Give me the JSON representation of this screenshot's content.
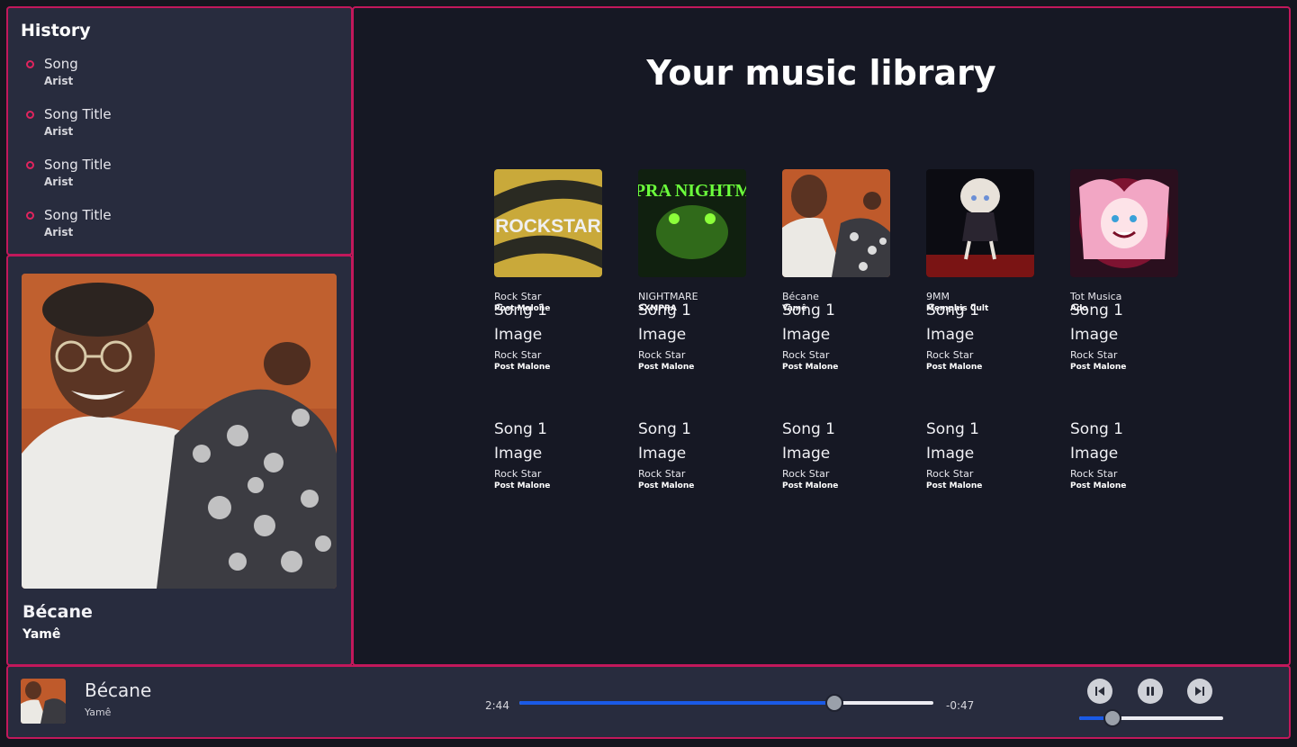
{
  "history": {
    "title": "History",
    "items": [
      {
        "song": "Song",
        "artist": "Arist"
      },
      {
        "song": "Song Title",
        "artist": "Arist"
      },
      {
        "song": "Song Title",
        "artist": "Arist"
      },
      {
        "song": "Song Title",
        "artist": "Arist"
      }
    ]
  },
  "now_playing": {
    "title": "Bécane",
    "artist": "Yamê"
  },
  "library": {
    "title": "Your music library",
    "albums": [
      {
        "title": "Rock Star",
        "artist": "Post Malone",
        "cover_text": "ROCKSTAR"
      },
      {
        "title": "NIGHTMARE",
        "artist": "SXMPRA",
        "cover_text": "SXMPRA NIGHTMARE"
      },
      {
        "title": "Bécane",
        "artist": "Yamê"
      },
      {
        "title": "9MM",
        "artist": "Memphis Cult"
      },
      {
        "title": "Tot Musica",
        "artist": "Ado"
      }
    ],
    "placeholders": [
      {
        "alt": "Song 1 Image",
        "title": "Rock Star",
        "artist": "Post Malone"
      },
      {
        "alt": "Song 1 Image",
        "title": "Rock Star",
        "artist": "Post Malone"
      },
      {
        "alt": "Song 1 Image",
        "title": "Rock Star",
        "artist": "Post Malone"
      },
      {
        "alt": "Song 1 Image",
        "title": "Rock Star",
        "artist": "Post Malone"
      },
      {
        "alt": "Song 1 Image",
        "title": "Rock Star",
        "artist": "Post Malone"
      },
      {
        "alt": "Song 1 Image",
        "title": "Rock Star",
        "artist": "Post Malone"
      },
      {
        "alt": "Song 1 Image",
        "title": "Rock Star",
        "artist": "Post Malone"
      },
      {
        "alt": "Song 1 Image",
        "title": "Rock Star",
        "artist": "Post Malone"
      },
      {
        "alt": "Song 1 Image",
        "title": "Rock Star",
        "artist": "Post Malone"
      },
      {
        "alt": "Song 1 Image",
        "title": "Rock Star",
        "artist": "Post Malone"
      }
    ]
  },
  "player": {
    "title": "Bécane",
    "artist": "Yamê",
    "elapsed": "2:44",
    "remaining": "-0:47",
    "progress": 0.76,
    "volume": 0.23,
    "prev_icon": "skip-previous-icon",
    "pause_icon": "pause-icon",
    "next_icon": "skip-next-icon"
  },
  "colors": {
    "accent_border": "#c2185b",
    "progress": "#1a5ae6",
    "panel": "#282c3e",
    "main_bg": "#161824"
  }
}
